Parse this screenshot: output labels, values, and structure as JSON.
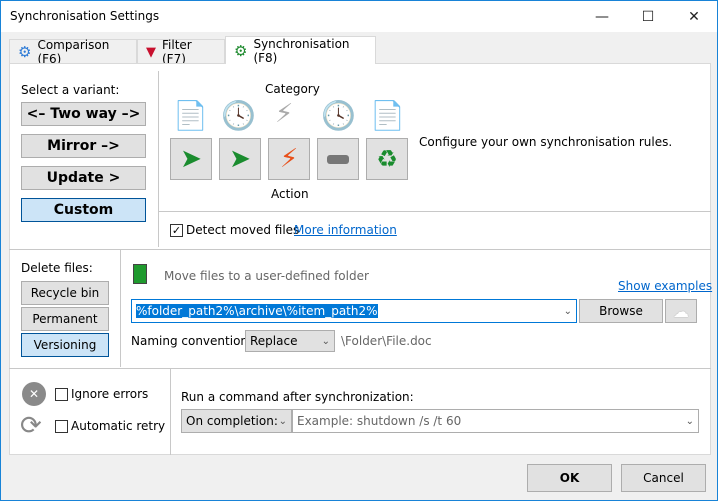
{
  "window": {
    "title": "Synchronisation Settings"
  },
  "tabs": [
    {
      "label": "Comparison (F6)",
      "icon": "gear-icon"
    },
    {
      "label": "Filter (F7)",
      "icon": "funnel-icon"
    },
    {
      "label": "Synchronisation (F8)",
      "icon": "gear-green-icon",
      "active": true
    }
  ],
  "variant": {
    "label": "Select a variant:",
    "options": [
      "<– Two way –>",
      "Mirror –>",
      "Update >",
      "Custom"
    ],
    "selected": "Custom"
  },
  "category_label": "Category",
  "action_label": "Action",
  "description": "Configure your own synchronisation rules.",
  "detect_moved": {
    "label": "Detect moved files",
    "checked": true,
    "link": "More information"
  },
  "delete": {
    "label": "Delete files:",
    "options": [
      "Recycle bin",
      "Permanent",
      "Versioning"
    ],
    "selected": "Versioning"
  },
  "versioning": {
    "hint": "Move files to a user-defined folder",
    "show_examples": "Show examples",
    "path": "%folder_path2%\\archive\\%item_path2%",
    "browse": "Browse",
    "naming_label": "Naming convention:",
    "naming_value": "Replace",
    "naming_example": "\\Folder\\File.doc"
  },
  "errors": {
    "ignore": "Ignore errors",
    "ignore_checked": false,
    "retry": "Automatic retry",
    "retry_checked": false
  },
  "command": {
    "label": "Run a command after synchronization:",
    "when": "On completion:",
    "placeholder": "Example: shutdown /s /t 60"
  },
  "footer": {
    "ok": "OK",
    "cancel": "Cancel"
  },
  "colors": {
    "accent": "#1883d7",
    "selection": "#0078d7",
    "selected_button": "#cce4f7"
  }
}
